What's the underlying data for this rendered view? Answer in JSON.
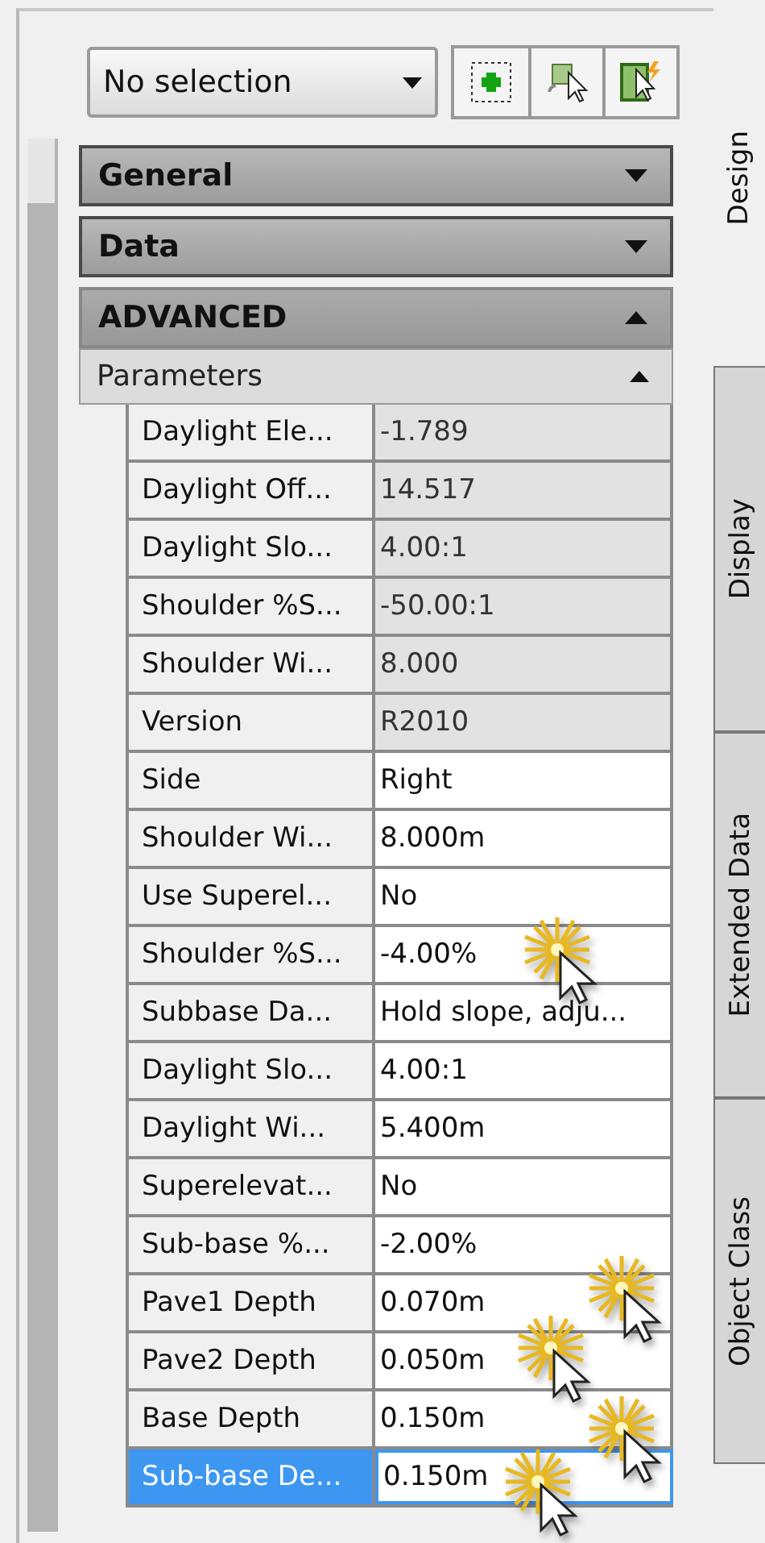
{
  "toolbar": {
    "selection": "No selection"
  },
  "sections": [
    {
      "title": "General",
      "expanded": false
    },
    {
      "title": "Data",
      "expanded": false
    },
    {
      "title": "ADVANCED",
      "expanded": true
    }
  ],
  "parameters": {
    "title": "Parameters",
    "expanded": true,
    "rows": [
      {
        "label": "Daylight Ele...",
        "value": "-1.789",
        "readonly": true,
        "selected": false
      },
      {
        "label": "Daylight Off...",
        "value": "14.517",
        "readonly": true,
        "selected": false
      },
      {
        "label": "Daylight Slo...",
        "value": "4.00:1",
        "readonly": true,
        "selected": false
      },
      {
        "label": "Shoulder %S...",
        "value": "-50.00:1",
        "readonly": true,
        "selected": false
      },
      {
        "label": "Shoulder Wi...",
        "value": "8.000",
        "readonly": true,
        "selected": false
      },
      {
        "label": "Version",
        "value": "R2010",
        "readonly": true,
        "selected": false
      },
      {
        "label": "Side",
        "value": "Right",
        "readonly": false,
        "selected": false
      },
      {
        "label": "Shoulder Wi...",
        "value": "8.000m",
        "readonly": false,
        "selected": false
      },
      {
        "label": "Use Superel...",
        "value": "No",
        "readonly": false,
        "selected": false
      },
      {
        "label": "Shoulder %S...",
        "value": "-4.00%",
        "readonly": false,
        "selected": false
      },
      {
        "label": "Subbase Da...",
        "value": "Hold slope, adju...",
        "readonly": false,
        "selected": false
      },
      {
        "label": "Daylight Slo...",
        "value": "4.00:1",
        "readonly": false,
        "selected": false
      },
      {
        "label": "Daylight Wi...",
        "value": "5.400m",
        "readonly": false,
        "selected": false
      },
      {
        "label": "Superelevat...",
        "value": "No",
        "readonly": false,
        "selected": false
      },
      {
        "label": "Sub-base %...",
        "value": "-2.00%",
        "readonly": false,
        "selected": false
      },
      {
        "label": "Pave1 Depth",
        "value": "0.070m",
        "readonly": false,
        "selected": false
      },
      {
        "label": "Pave2 Depth",
        "value": "0.050m",
        "readonly": false,
        "selected": false
      },
      {
        "label": "Base Depth",
        "value": "0.150m",
        "readonly": false,
        "selected": false
      },
      {
        "label": "Sub-base De...",
        "value": "0.150m",
        "readonly": false,
        "selected": true
      }
    ]
  },
  "tabs": [
    {
      "label": "Design",
      "selected": true
    },
    {
      "label": "Display",
      "selected": false
    },
    {
      "label": "Extended Data",
      "selected": false
    },
    {
      "label": "Object Class",
      "selected": false
    }
  ]
}
